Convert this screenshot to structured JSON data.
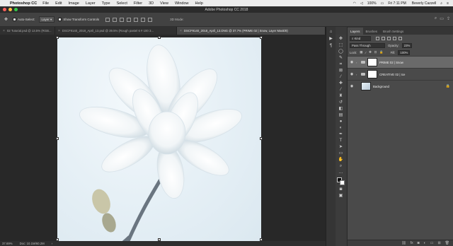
{
  "menubar": {
    "app_name": "Photoshop CC",
    "items": [
      "File",
      "Edit",
      "Image",
      "Layer",
      "Type",
      "Select",
      "Filter",
      "3D",
      "View",
      "Window",
      "Help"
    ],
    "battery": "100%",
    "clock": "Fri 7:11 PM",
    "user": "Beverly Cazzell"
  },
  "window": {
    "title": "Adobe Photoshop CC 2018"
  },
  "options": {
    "auto_select_label": "Auto-Select:",
    "auto_select_value": "Layer",
    "transform_label": "Show Transform Controls",
    "mode_3d": "3D Mode:"
  },
  "doc_tabs": [
    {
      "label": "02 Tutorial.psd @ 13.5% (RGB...",
      "active": false
    },
    {
      "label": "DSCF9140_2018_April_13.psd @ 39.5% (Rough pastel 6 # 100 3...",
      "active": false
    },
    {
      "label": "DSCF9140_2018_April_13.DNG @ 37.7% (PRIME 02 | Snow, Layer Mask/8)",
      "active": true
    }
  ],
  "status": {
    "zoom": "37.69%",
    "doc": "Doc: 10.1M/60.2M"
  },
  "panel": {
    "tabs": [
      "Layers",
      "Brushes",
      "Brush Settings"
    ],
    "filter_kind": "Kind",
    "blend_mode": "Pass Through",
    "opacity_label": "Opacity:",
    "opacity_value": "23%",
    "lock_label": "Lock:",
    "fill_label": "Fill:",
    "fill_value": "100%",
    "layers": [
      {
        "name": "PRIME 02 | Snow",
        "type": "group",
        "selected": true
      },
      {
        "name": "CREATIVE 02 | Ice",
        "type": "group",
        "selected": false
      },
      {
        "name": "Background",
        "type": "image",
        "selected": false
      }
    ]
  },
  "colors": {
    "foreground": "#000000",
    "background": "#ffffff",
    "accent": "#6a6a6a"
  }
}
